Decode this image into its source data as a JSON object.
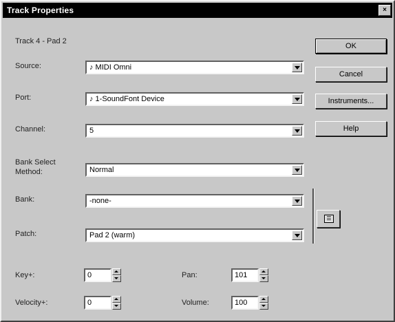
{
  "window": {
    "title": "Track Properties",
    "close": "×"
  },
  "track_name": "Track 4 - Pad 2",
  "fields": {
    "source": {
      "label": "Source:",
      "value": "♪ MIDI Omni"
    },
    "port": {
      "label": "Port:",
      "value": "♪ 1-SoundFont Device"
    },
    "channel": {
      "label": "Channel:",
      "value": "5"
    },
    "bank_select": {
      "label_line1": "Bank Select",
      "label_line2": "Method:",
      "value": "Normal"
    },
    "bank": {
      "label": "Bank:",
      "value": "-none-"
    },
    "patch": {
      "label": "Patch:",
      "value": "Pad 2 (warm)"
    }
  },
  "buttons": {
    "ok": "OK",
    "cancel": "Cancel",
    "instruments": "Instruments...",
    "help": "Help"
  },
  "spinners": {
    "key": {
      "label": "Key+:",
      "value": "0"
    },
    "velocity": {
      "label": "Velocity+:",
      "value": "0"
    },
    "pan": {
      "label": "Pan:",
      "value": "101"
    },
    "volume": {
      "label": "Volume:",
      "value": "100"
    }
  }
}
